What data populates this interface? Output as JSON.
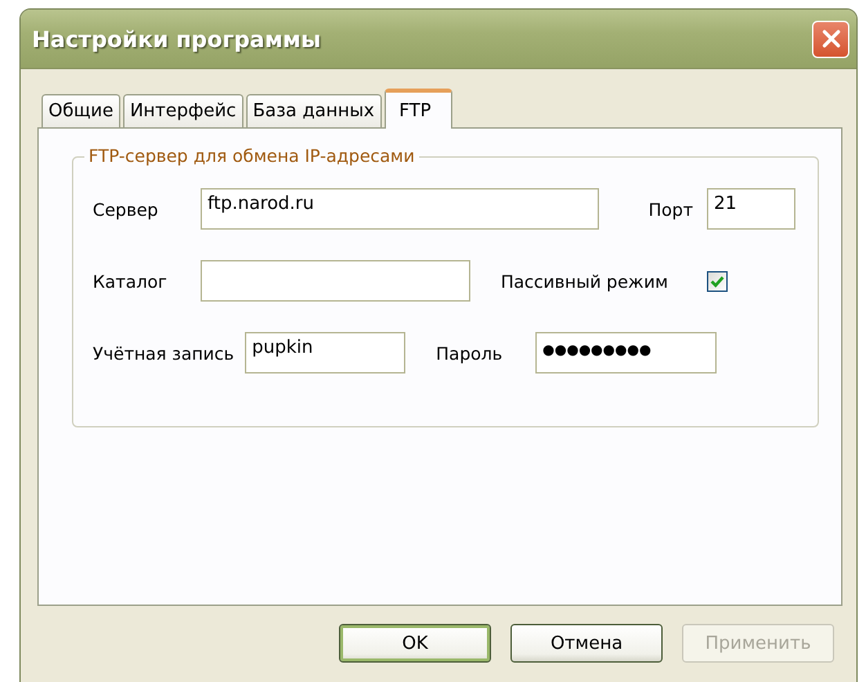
{
  "window": {
    "title": "Настройки программы"
  },
  "tabs": [
    {
      "label": "Общие",
      "selected": false
    },
    {
      "label": "Интерфейс",
      "selected": false
    },
    {
      "label": "База данных",
      "selected": false
    },
    {
      "label": "FTP",
      "selected": true
    }
  ],
  "group": {
    "title": "FTP-сервер для обмена IP-адресами",
    "server": {
      "label": "Сервер",
      "value": "ftp.narod.ru"
    },
    "port": {
      "label": "Порт",
      "value": "21"
    },
    "catalog": {
      "label": "Каталог"
    },
    "passive": {
      "label": "Пассивный режим",
      "checked": true
    },
    "account": {
      "label": "Учётная запись",
      "value": "pupkin"
    },
    "password": {
      "label": "Пароль",
      "value": "●●●●●●●●●"
    }
  },
  "buttons": [
    {
      "label": "OK",
      "disabled": false,
      "default": true
    },
    {
      "label": "Отмена",
      "disabled": false,
      "default": false
    },
    {
      "label": "Применить",
      "disabled": true,
      "default": false
    }
  ]
}
